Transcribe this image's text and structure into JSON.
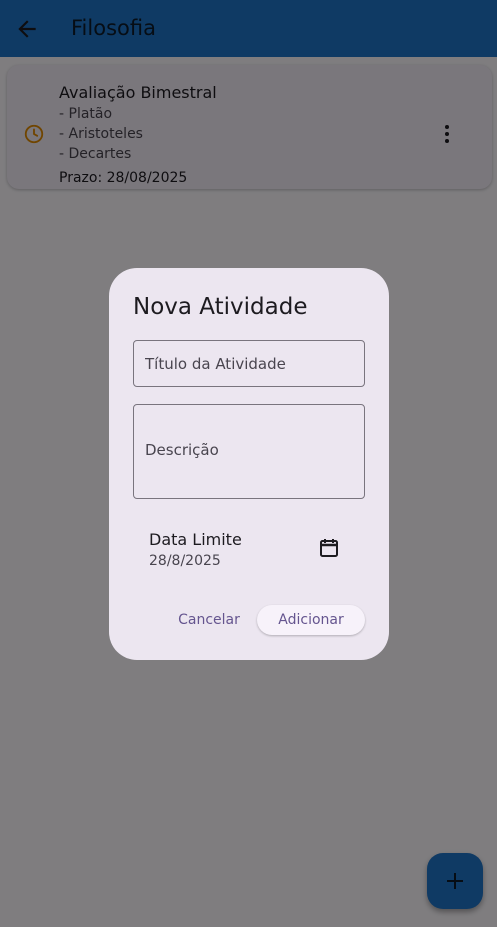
{
  "appbar": {
    "title": "Filosofia",
    "back_icon": "arrow-back-icon",
    "color": "#1f75c9"
  },
  "activity_card": {
    "title": "Avaliação Bimestral",
    "lines": [
      "- Platão",
      "- Aristoteles",
      "- Decartes"
    ],
    "deadline": "Prazo: 28/08/2025",
    "status_icon": "clock-icon",
    "status_color": "#e08a00",
    "menu_icon": "more-vert-icon"
  },
  "fab": {
    "icon": "plus-icon"
  },
  "dialog": {
    "title": "Nova Atividade",
    "title_field_placeholder": "Título da Atividade",
    "title_field_value": "",
    "description_placeholder": "Descrição",
    "description_value": "",
    "date_label": "Data Limite",
    "date_value": "28/8/2025",
    "calendar_icon": "calendar-icon",
    "cancel_label": "Cancelar",
    "add_label": "Adicionar"
  }
}
